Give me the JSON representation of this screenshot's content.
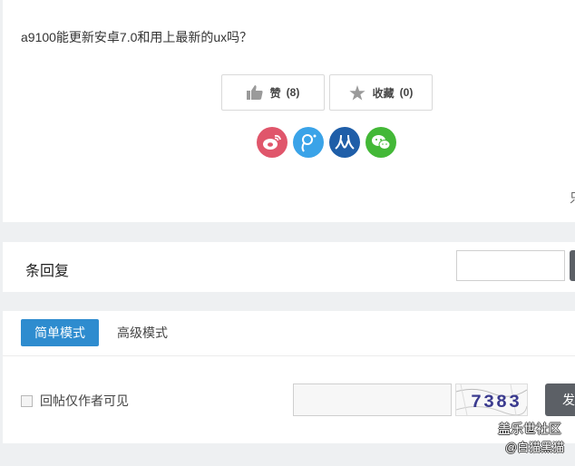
{
  "post": {
    "text": "a9100能更新安卓7.0和用上最新的ux吗？",
    "like_label": "赞",
    "like_count": "(8)",
    "fav_label": "收藏",
    "fav_count": "(0)",
    "share_icons": [
      "weibo-icon",
      "tencent-weibo-icon",
      "renren-icon",
      "wechat-icon"
    ],
    "edge_glyph": "只"
  },
  "reply_bar": {
    "title": "条回复"
  },
  "editor": {
    "tab_simple": "简单模式",
    "tab_advanced": "高级模式",
    "only_author_label": "回帖仅作者可见",
    "captcha_text": "7383",
    "submit_label": "发"
  },
  "watermark": {
    "line1": "盖乐世社区",
    "line2": "@白猫黑猫"
  },
  "colors": {
    "primary": "#2e8ccf",
    "dark_button": "#5c6066",
    "weibo": "#e0566b",
    "tencent": "#3aa3e8",
    "renren": "#1f5ea8",
    "wechat": "#43b837"
  }
}
